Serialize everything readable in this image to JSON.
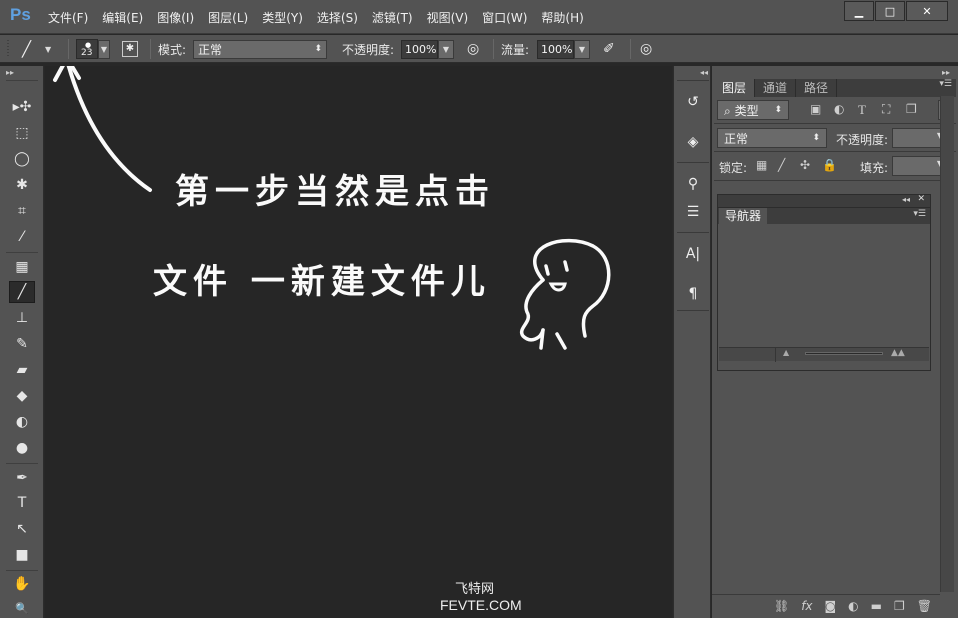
{
  "app": {
    "logo": "Ps"
  },
  "menu": [
    "文件(F)",
    "编辑(E)",
    "图像(I)",
    "图层(L)",
    "类型(Y)",
    "选择(S)",
    "滤镜(T)",
    "视图(V)",
    "窗口(W)",
    "帮助(H)"
  ],
  "window_controls": {
    "minimize": "▁",
    "maximize": "□",
    "close": "✕"
  },
  "options_bar": {
    "brush_size": "23",
    "mode_label": "模式:",
    "mode_value": "正常",
    "opacity_label": "不透明度:",
    "opacity_value": "100%",
    "flow_label": "流量:",
    "flow_value": "100%"
  },
  "tools": [
    {
      "icon": "move-tool-icon",
      "glyph": "▸✣"
    },
    {
      "icon": "marquee-tool-icon",
      "glyph": "⬚"
    },
    {
      "icon": "lasso-tool-icon",
      "glyph": "◯"
    },
    {
      "icon": "magic-wand-icon",
      "glyph": "✱"
    },
    {
      "icon": "crop-tool-icon",
      "glyph": "⌗"
    },
    {
      "icon": "eyedropper-icon",
      "glyph": "⁄"
    },
    {
      "icon": "healing-brush-icon",
      "glyph": "▦"
    },
    {
      "icon": "brush-tool-icon",
      "glyph": "╱"
    },
    {
      "icon": "clone-stamp-icon",
      "glyph": "⊥"
    },
    {
      "icon": "history-brush-icon",
      "glyph": "✎"
    },
    {
      "icon": "eraser-icon",
      "glyph": "▰"
    },
    {
      "icon": "paint-bucket-icon",
      "glyph": "◆"
    },
    {
      "icon": "blur-tool-icon",
      "glyph": "◐"
    },
    {
      "icon": "dodge-tool-icon",
      "glyph": "●"
    },
    {
      "icon": "pen-tool-icon",
      "glyph": "✒"
    },
    {
      "icon": "type-tool-icon",
      "glyph": "T"
    },
    {
      "icon": "path-selection-icon",
      "glyph": "↖"
    },
    {
      "icon": "rectangle-tool-icon",
      "glyph": "■"
    },
    {
      "icon": "hand-tool-icon",
      "glyph": "✋"
    },
    {
      "icon": "zoom-tool-icon",
      "glyph": "🔍"
    }
  ],
  "canvas": {
    "line1": "第一步当然是点击",
    "line2": "文件 一新建文件儿",
    "watermark_cn": "飞特网",
    "watermark_en": "FEVTE.COM"
  },
  "dock": [
    {
      "icon": "history-icon",
      "glyph": "↺"
    },
    {
      "icon": "properties-icon",
      "glyph": "◈"
    },
    {
      "icon": "brush-presets-icon",
      "glyph": "⚲"
    },
    {
      "icon": "brush-panel-icon",
      "glyph": "☰"
    },
    {
      "icon": "character-icon",
      "glyph": "A|"
    },
    {
      "icon": "paragraph-icon",
      "glyph": "¶"
    }
  ],
  "layers_panel": {
    "tabs": [
      "图层",
      "通道",
      "路径"
    ],
    "filter_kind": "类型",
    "blend_mode": "正常",
    "opacity_label": "不透明度:",
    "lock_label": "锁定:",
    "fill_label": "填充:"
  },
  "navigator": {
    "tab": "导航器"
  }
}
